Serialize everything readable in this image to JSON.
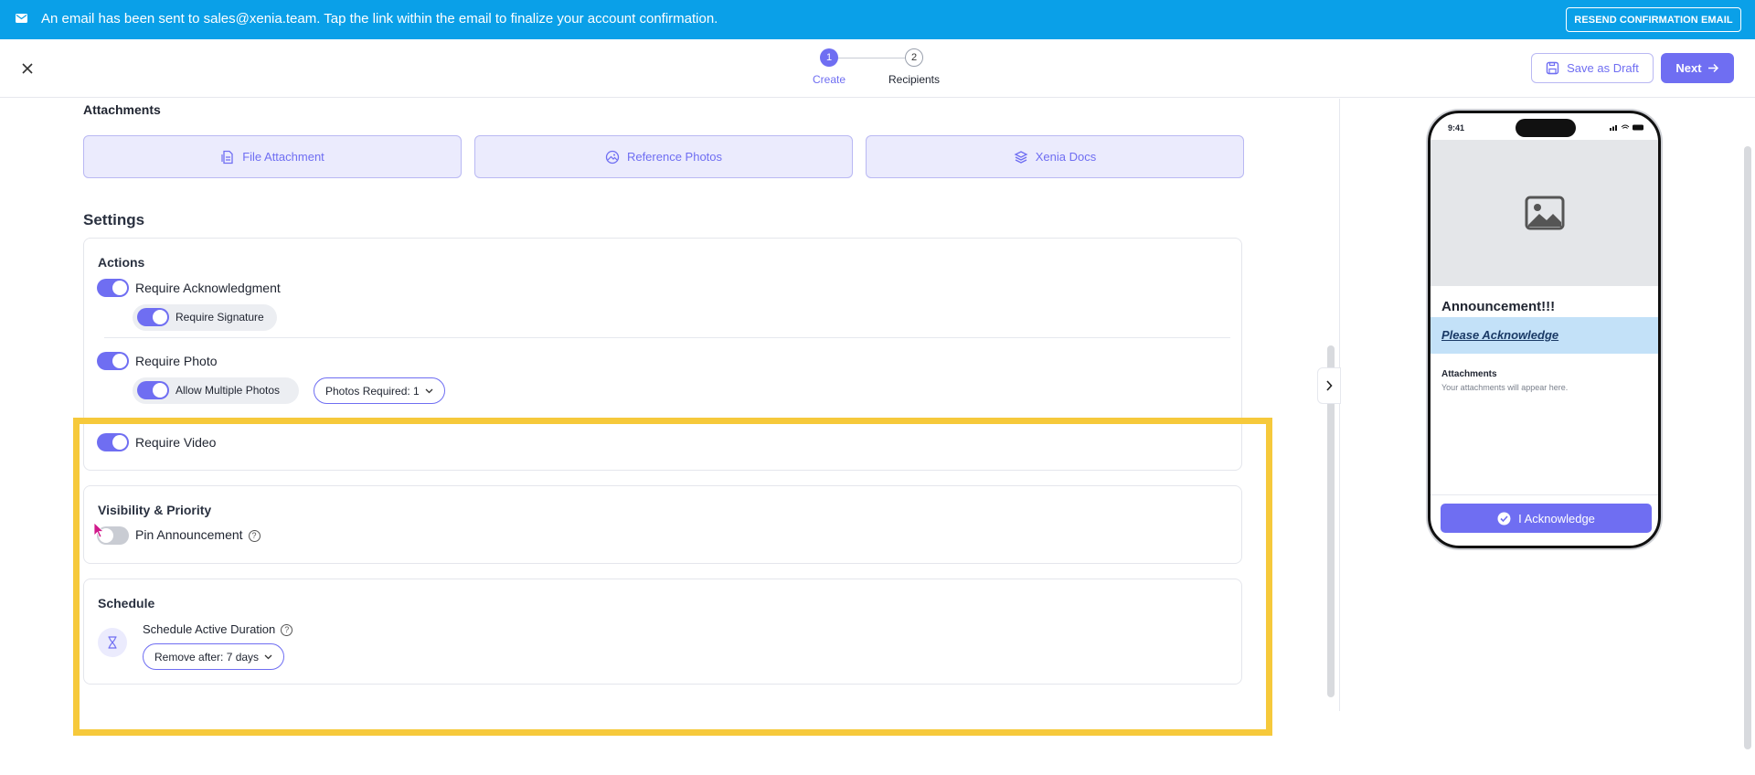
{
  "banner": {
    "message": "An email has been sent to sales@xenia.team. Tap the link within the email to finalize your account confirmation.",
    "resend_label": "RESEND CONFIRMATION EMAIL",
    "icon": "mail-icon"
  },
  "header": {
    "steps": [
      {
        "number": "1",
        "label": "Create",
        "active": true
      },
      {
        "number": "2",
        "label": "Recipients",
        "active": false
      }
    ],
    "save_draft_label": "Save as Draft",
    "next_label": "Next"
  },
  "attachments": {
    "title": "Attachments",
    "buttons": [
      {
        "label": "File Attachment",
        "icon": "file-attachment-icon"
      },
      {
        "label": "Reference Photos",
        "icon": "photo-icon"
      },
      {
        "label": "Xenia Docs",
        "icon": "docs-stack-icon"
      }
    ]
  },
  "settings": {
    "title": "Settings",
    "actions": {
      "title": "Actions",
      "require_ack": {
        "label": "Require Acknowledgment",
        "on": true
      },
      "require_signature": {
        "label": "Require Signature",
        "on": true
      },
      "require_photo": {
        "label": "Require Photo",
        "on": true
      },
      "allow_multiple_photos": {
        "label": "Allow Multiple Photos",
        "on": true
      },
      "photos_required": "Photos Required: 1",
      "require_video": {
        "label": "Require Video",
        "on": true
      }
    },
    "visibility": {
      "title": "Visibility & Priority",
      "pin": {
        "label": "Pin Announcement",
        "on": false
      }
    },
    "schedule": {
      "title": "Schedule",
      "duration_label": "Schedule Active Duration",
      "remove_after": "Remove after: 7 days"
    }
  },
  "preview": {
    "time": "9:41",
    "title": "Announcement!!!",
    "ack_link": "Please Acknowledge",
    "attachments_title": "Attachments",
    "attachments_hint": "Your attachments will appear here.",
    "ack_button": "I Acknowledge"
  },
  "colors": {
    "accent": "#6f6ef2",
    "banner": "#0aa0e8",
    "highlight": "#f6c93b"
  }
}
